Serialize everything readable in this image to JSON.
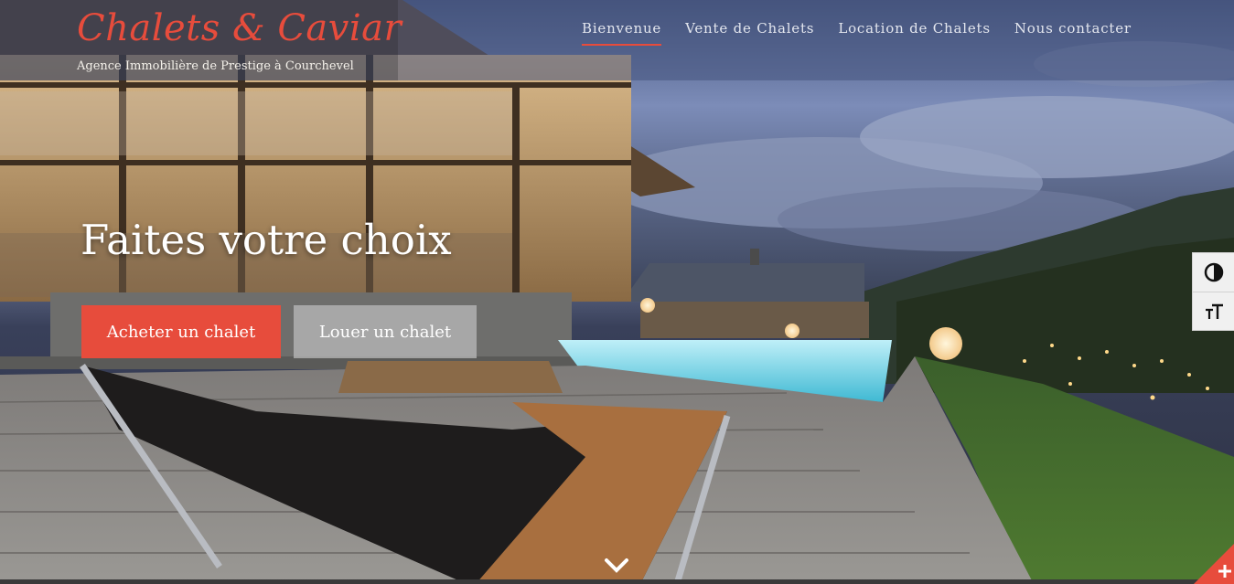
{
  "brand": {
    "title": "Chalets & Caviar",
    "subtitle": "Agence Immobilière de Prestige à Courchevel"
  },
  "nav": {
    "items": [
      {
        "label": "Bienvenue",
        "active": true
      },
      {
        "label": "Vente de Chalets",
        "active": false
      },
      {
        "label": "Location de Chalets",
        "active": false
      },
      {
        "label": "Nous contacter",
        "active": false
      }
    ]
  },
  "hero": {
    "title": "Faites votre choix",
    "buy_button": "Acheter un chalet",
    "rent_button": "Louer un chalet"
  },
  "tools": {
    "contrast_icon": "contrast-icon",
    "text_size_icon": "text-size-icon"
  },
  "icons": {
    "scroll": "chevron-down-icon",
    "corner": "plus-icon"
  },
  "colors": {
    "accent": "#e74c3c",
    "header_overlay": "#46547d",
    "button_secondary": "#bebebe"
  }
}
